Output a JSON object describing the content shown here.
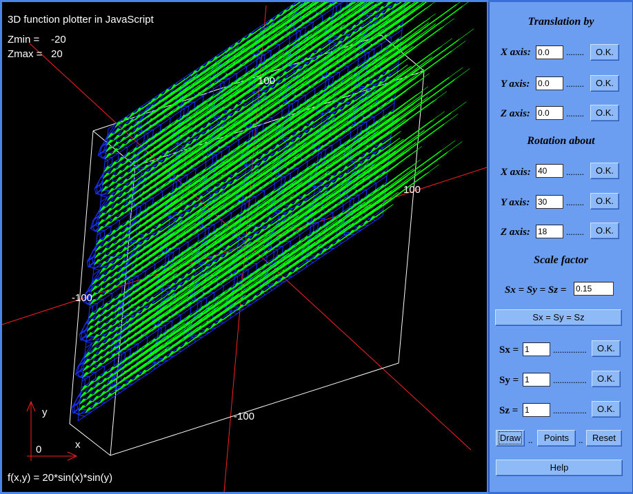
{
  "plot": {
    "title": "3D function plotter in JavaScript",
    "zmin_label": "Zmin =",
    "zmin_value": "-20",
    "zmax_label": "Zmax =",
    "zmax_value": "20",
    "function_text": "f(x,y) = 20*sin(x)*sin(y)",
    "tick_y_pos": "100",
    "tick_x_pos": "100",
    "tick_x_neg": "-100",
    "tick_y_neg": "-100",
    "gizmo_y": "y",
    "gizmo_x": "x",
    "gizmo_origin": "0",
    "colors": {
      "background": "#000000",
      "surface": "#00ff00",
      "mesh": "#1830ff",
      "axes": "#ff2020",
      "box": "#ffffff"
    }
  },
  "translation": {
    "title": "Translation by",
    "x_label": "X axis:",
    "x_value": "0.0",
    "y_label": "Y axis:",
    "y_value": "0.0",
    "z_label": "Z axis:",
    "z_value": "0.0",
    "ok_label": "O.K."
  },
  "rotation": {
    "title": "Rotation about",
    "x_label": "X axis:",
    "x_value": "40",
    "y_label": "Y axis:",
    "y_value": "30",
    "z_label": "Z axis:",
    "z_value": "18",
    "ok_label": "O.K."
  },
  "scale": {
    "title": "Scale factor",
    "uniform_label": "Sx = Sy = Sz =",
    "uniform_value": "0.15",
    "uniform_button": "Sx = Sy = Sz",
    "sx_label": "Sx =",
    "sx_value": "1",
    "sy_label": "Sy =",
    "sy_value": "1",
    "sz_label": "Sz =",
    "sz_value": "1",
    "ok_label": "O.K."
  },
  "actions": {
    "draw": "Draw",
    "points": "Points",
    "reset": "Reset",
    "help": "Help",
    "sep": ".."
  },
  "dots": {
    "short": "........",
    "long": "..............."
  }
}
